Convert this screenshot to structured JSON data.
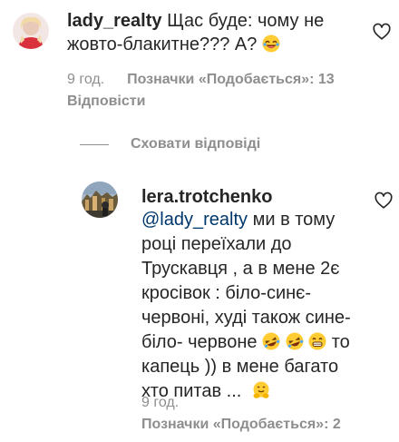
{
  "comment1": {
    "username": "lady_realty",
    "text_line1": "Щас буде: чому не",
    "text_line2": "жовто-блакитне??? А?",
    "time": "9 год.",
    "likes_label": "Позначки «Подобається»: 13",
    "reply_label": "Відповісти"
  },
  "hide_replies_label": "Сховати відповіді",
  "reply1": {
    "username": "lera.trotchenko",
    "mention": "@lady_realty",
    "line1_rest": " ми в тому",
    "line2": "році переїхали до",
    "line3": "Трускавця , а в мене 2є",
    "line4": "кросівок : біло-синє-",
    "line5": "червоні, худі також сине-",
    "line6_start": "біло- червоне",
    "line6_end": "то",
    "line7": "капець )) в мене багато",
    "line8": "хто питав ...",
    "time": "9 год.",
    "likes_label": "Позначки «Подобається»: 2"
  },
  "colors": {
    "text": "#262626",
    "meta": "#8e8e8e",
    "mention": "#00376b"
  }
}
